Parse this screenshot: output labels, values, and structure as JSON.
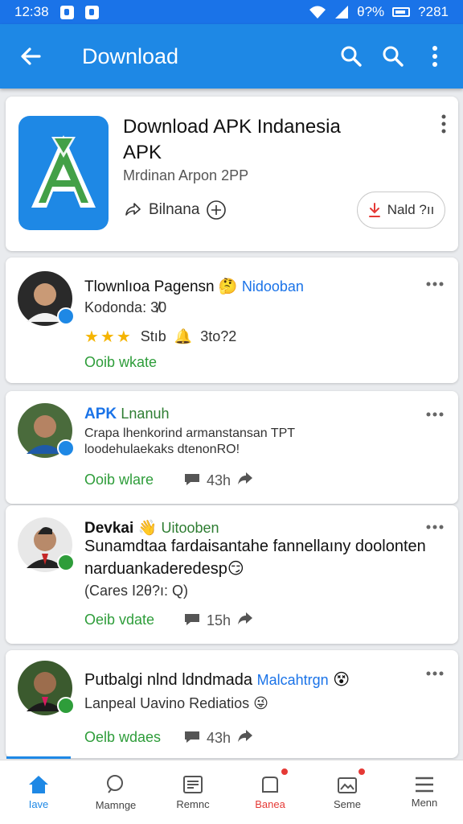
{
  "status_bar": {
    "time": "12:38",
    "right": "θ?%",
    "battery_text": "?281"
  },
  "app_bar": {
    "title": "Download"
  },
  "app_card": {
    "title": "Download APK Indanesia APK",
    "subtitle": "Mrdinan Arpon 2PP",
    "meta": "Bilnana",
    "button": "Nald ?ıı"
  },
  "posts": [
    {
      "name": "Tlownlıoa Pagensn",
      "tag": "Nidooban",
      "line1": "Kodonda: 3̸0",
      "stars": "Stıb",
      "rating": "3to?2",
      "action": "Ooib wkate"
    },
    {
      "name": "APK",
      "tag": "Lnanuh",
      "line1": "Crapa lhenkorind armanstansan TPT",
      "line2": "loodehulaekaks dtenonRO!",
      "action": "Ooib wlare",
      "time": "43h"
    },
    {
      "name": "Devkai",
      "tag": "Uitooben",
      "line1": "Sunamdtaa fardaisantahe fannellaıny doolonten",
      "line2": "narduankaderedesp",
      "line3": "(Cares I2θ?ı: Q)",
      "action": "Oeib vdate",
      "time": "15h"
    },
    {
      "name": "Putbalgi nlnd ldndmada",
      "tag": "Malcahtrgn",
      "line1": "Lanpeal Uavino Rediatios",
      "action": "Oelb wdaes",
      "time": "43h"
    }
  ],
  "bottom_nav": [
    {
      "label": "Iave",
      "icon": "home-icon",
      "state": "active"
    },
    {
      "label": "Mamnge",
      "icon": "search-icon",
      "state": "normal"
    },
    {
      "label": "Remnc",
      "icon": "news-icon",
      "state": "normal"
    },
    {
      "label": "Banea",
      "icon": "notification-icon",
      "state": "alert"
    },
    {
      "label": "Seme",
      "icon": "image-icon",
      "state": "normal"
    },
    {
      "label": "Menn",
      "icon": "menu-icon",
      "state": "normal"
    }
  ],
  "colors": {
    "primary": "#1e88e5",
    "action_green": "#2e9d3a",
    "alert_red": "#e53935",
    "star": "#f5b400"
  }
}
